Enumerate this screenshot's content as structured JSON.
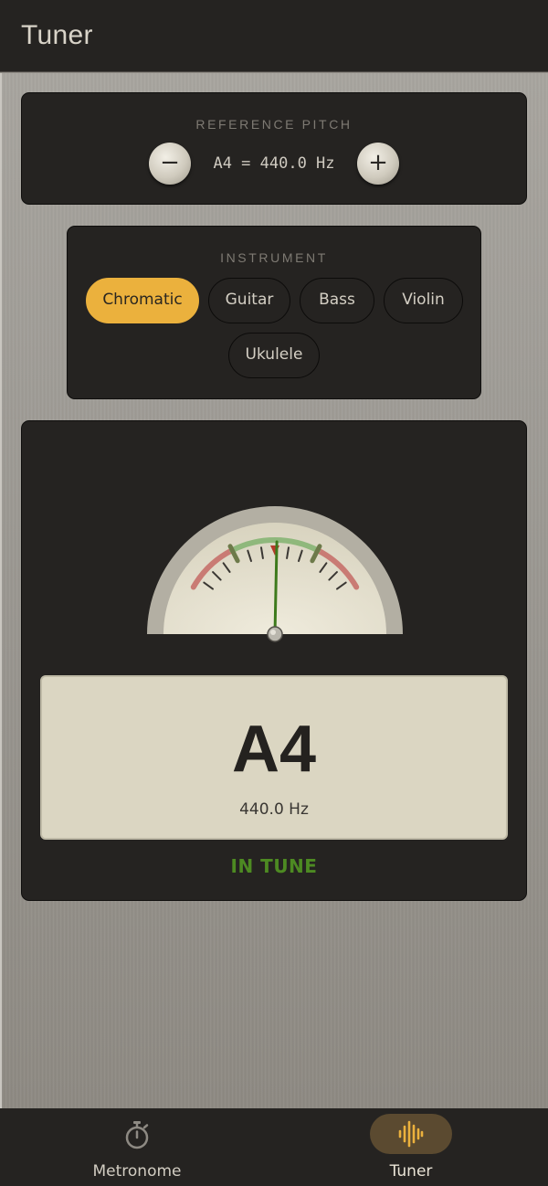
{
  "app_bar": {
    "title": "Tuner"
  },
  "reference_pitch": {
    "label": "REFERENCE PITCH",
    "value": "A4 = 440.0 Hz",
    "decrement_symbol": "−",
    "increment_symbol": "+"
  },
  "instrument": {
    "label": "INSTRUMENT",
    "options": [
      "Chromatic",
      "Guitar",
      "Bass",
      "Violin",
      "Ukulele"
    ],
    "selected": "Chromatic"
  },
  "tuner": {
    "note": "A4",
    "frequency": "440.0 Hz",
    "status": "IN TUNE",
    "needle_deviation_fraction": 0.02
  },
  "bottom_nav": {
    "items": [
      {
        "label": "Metronome",
        "icon": "stopwatch-icon",
        "active": false
      },
      {
        "label": "Tuner",
        "icon": "audio-wave-icon",
        "active": true
      }
    ]
  },
  "colors": {
    "accent": "#ebb13d",
    "in_tune": "#4d8a22",
    "panel": "#252321",
    "readout": "#dbd6c2"
  }
}
